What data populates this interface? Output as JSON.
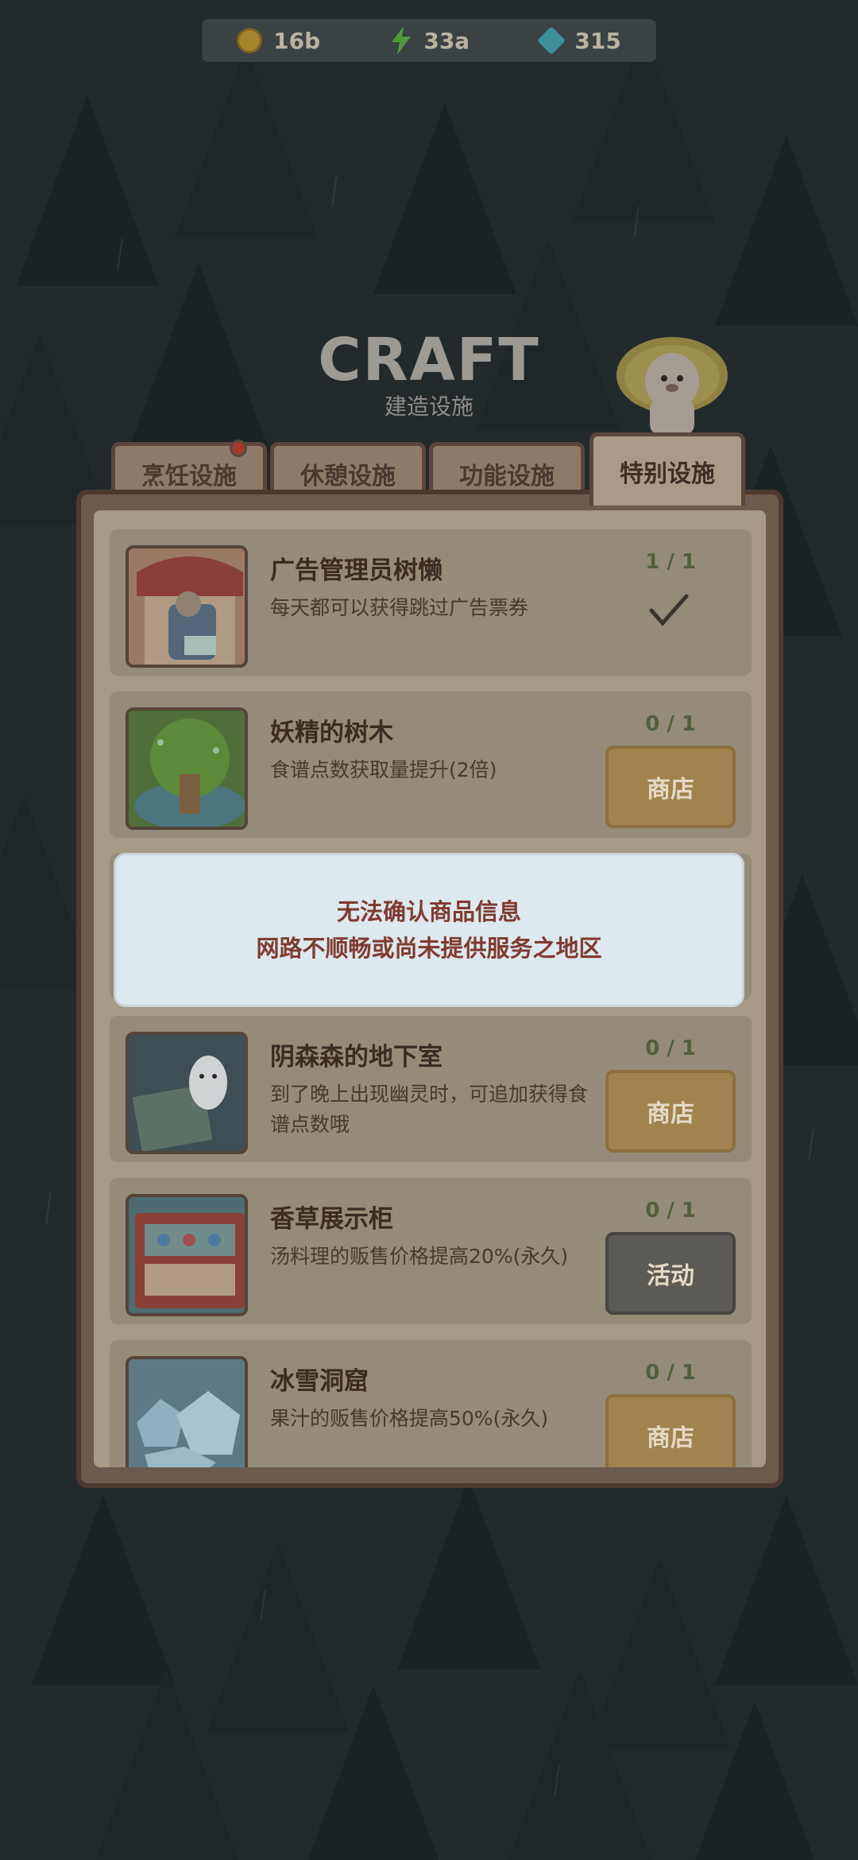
{
  "currency": {
    "coins": "16b",
    "energy": "33a",
    "gems": "315"
  },
  "header": {
    "title": "CRAFT",
    "subtitle": "建造设施"
  },
  "tabs": [
    {
      "label": "烹饪设施",
      "has_badge": true
    },
    {
      "label": "休憩设施"
    },
    {
      "label": "功能设施"
    },
    {
      "label": "特别设施",
      "active": true
    }
  ],
  "items": [
    {
      "name": "广告管理员树懒",
      "desc": "每天都可以获得跳过广告票券",
      "count": "1 / 1",
      "status": "owned"
    },
    {
      "name": "妖精的树木",
      "desc": "食谱点数获取量提升(2倍)",
      "count": "0 / 1",
      "button": "商店"
    },
    {
      "name": "阴森森的地下室",
      "desc": "到了晚上出现幽灵时，可追加获得食谱点数哦",
      "count": "0 / 1",
      "button": "商店"
    },
    {
      "name": "香草展示柜",
      "desc": "汤料理的贩售价格提高20%(永久)",
      "count": "0 / 1",
      "button": "活动"
    },
    {
      "name": "冰雪洞窟",
      "desc": "果汁的贩售价格提高50%(永久)",
      "count": "0 / 1",
      "button": "商店"
    }
  ],
  "toast": {
    "line1": "无法确认商品信息",
    "line2": "网路不顺畅或尚未提供服务之地区"
  }
}
